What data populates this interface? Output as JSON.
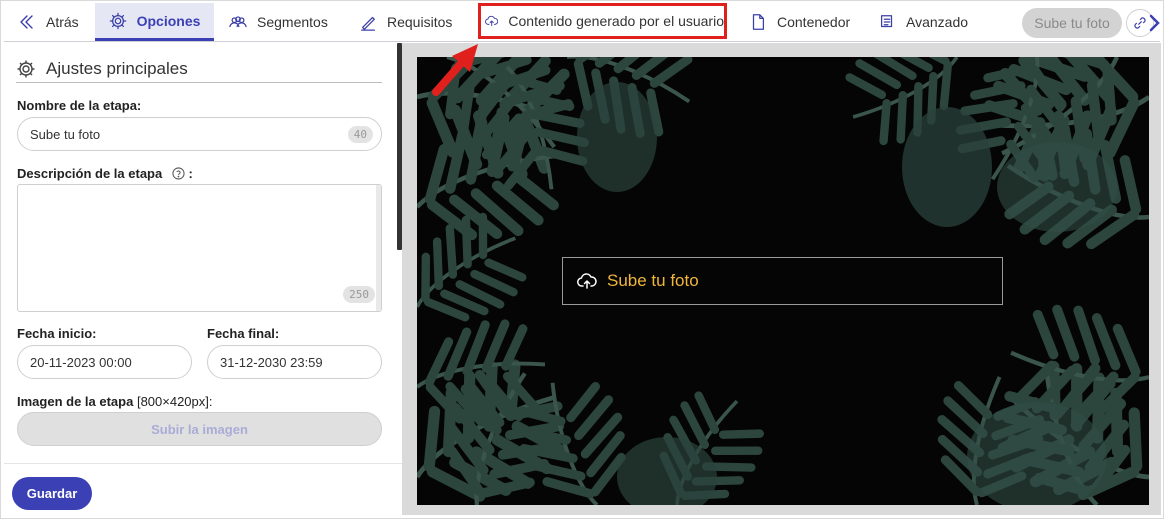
{
  "nav": {
    "back": "Atrás",
    "tabs": [
      {
        "label": "Opciones",
        "icon": "gear-icon",
        "active": true
      },
      {
        "label": "Segmentos",
        "icon": "users-icon"
      },
      {
        "label": "Requisitos",
        "icon": "pen-icon"
      },
      {
        "label": "Contenido generado por el usuario",
        "icon": "cloud-upload-icon",
        "highlighted": true
      },
      {
        "label": "Contenedor",
        "icon": "document-icon"
      },
      {
        "label": "Avanzado",
        "icon": "notes-icon"
      }
    ],
    "stage_button": "Sube tu foto"
  },
  "form": {
    "section_title": "Ajustes principales",
    "name_label": "Nombre de la etapa:",
    "name_value": "Sube tu foto",
    "name_counter": "40",
    "description_label": "Descripción de la etapa",
    "description_suffix": ":",
    "description_counter": "250",
    "start_label": "Fecha inicio:",
    "start_value": "20-11-2023 00:00",
    "end_label": "Fecha final:",
    "end_value": "31-12-2030 23:59",
    "image_label": "Imagen de la etapa",
    "image_hint": "[800×420px]:",
    "upload_button": "Subir la imagen",
    "save_button": "Guardar"
  },
  "preview": {
    "cta_label": "Sube tu foto"
  },
  "colors": {
    "accent": "#3b40b5",
    "highlight_border": "#e0201c",
    "cta_text": "#f0b63c",
    "preview_bg": "#050505"
  }
}
